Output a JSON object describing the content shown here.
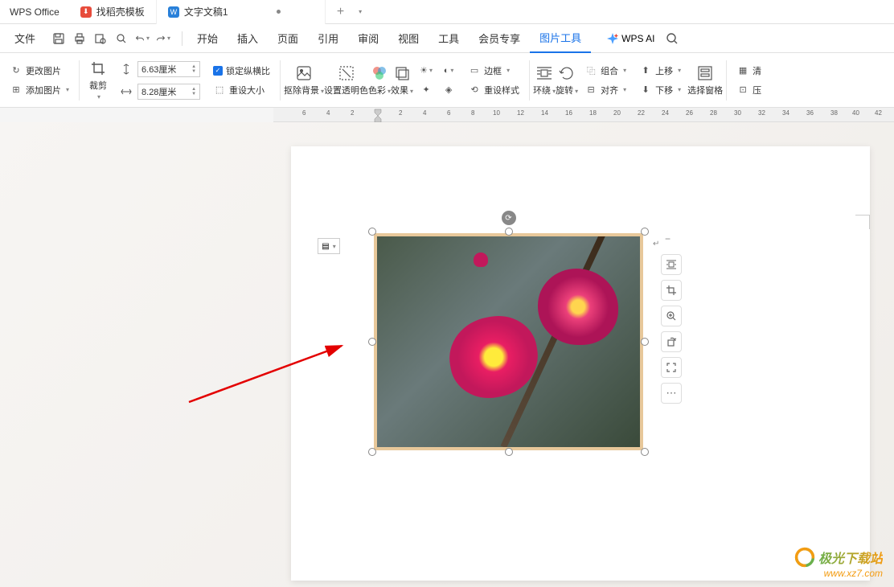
{
  "app": {
    "name": "WPS Office"
  },
  "tabs": [
    {
      "label": "找稻壳模板",
      "icon_bg": "#e74c3c",
      "icon_text": "D"
    },
    {
      "label": "文字文稿1",
      "icon_bg": "#2980d9",
      "icon_text": "W",
      "modified": true
    }
  ],
  "menu": {
    "file": "文件",
    "items": [
      "开始",
      "插入",
      "页面",
      "引用",
      "审阅",
      "视图",
      "工具",
      "会员专享",
      "图片工具"
    ],
    "active": "图片工具",
    "ai_label": "WPS AI"
  },
  "ribbon": {
    "change_pic": "更改图片",
    "add_pic": "添加图片",
    "crop": "裁剪",
    "width": "6.63厘米",
    "height": "8.28厘米",
    "lock_ratio": "锁定纵横比",
    "reset_size": "重设大小",
    "remove_bg": "抠除背景",
    "transparent": "设置透明色",
    "color": "色彩",
    "effect": "效果",
    "border": "边框",
    "reset_style": "重设样式",
    "wrap": "环绕",
    "rotate": "旋转",
    "group": "组合",
    "align": "对齐",
    "move_up": "上移",
    "move_down": "下移",
    "select_pane": "选择窗格",
    "clear": "清",
    "compress": "压"
  },
  "ruler": {
    "marks": [
      "6",
      "4",
      "2",
      "",
      "2",
      "4",
      "6",
      "8",
      "10",
      "12",
      "14",
      "16",
      "18",
      "20",
      "22",
      "24",
      "26",
      "28",
      "30",
      "32",
      "34",
      "36",
      "38",
      "40",
      "42"
    ]
  },
  "watermark": {
    "text": "极光下载站",
    "url": "www.xz7.com"
  }
}
